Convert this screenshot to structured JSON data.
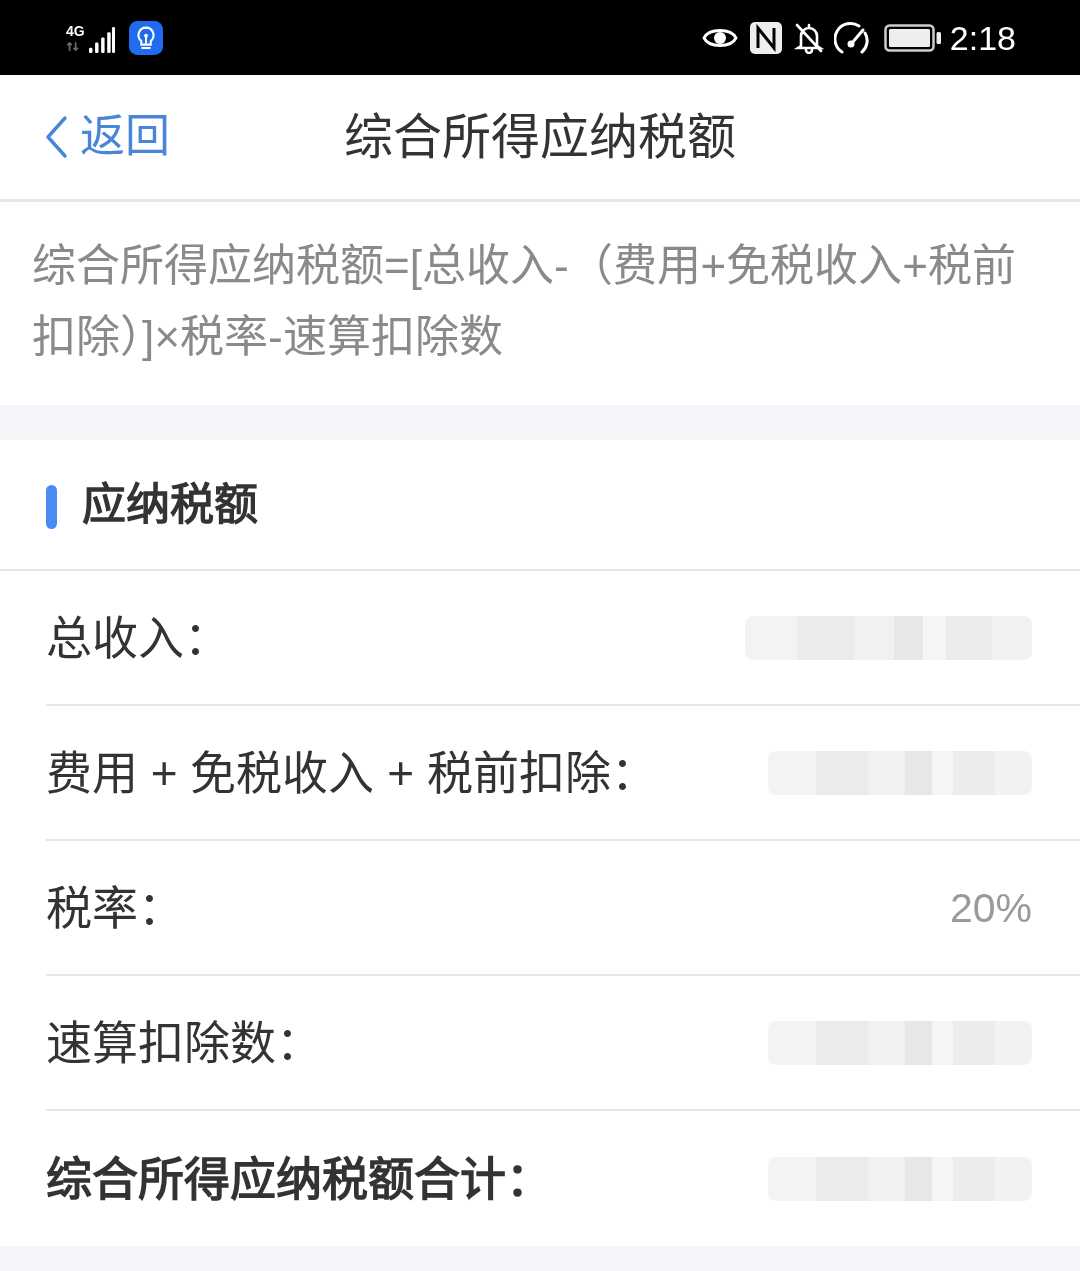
{
  "status_bar": {
    "network": "4G",
    "time": "2:18"
  },
  "nav_bar": {
    "back": "返回",
    "title": "综合所得应纳税额"
  },
  "formula": "综合所得应纳税额=[总收入-（费用+免税收入+税前扣除）]×税率-速算扣除数",
  "section": {
    "title": "应纳税额",
    "rows": [
      {
        "label": "总收入：",
        "blurred": true,
        "emphasized": false
      },
      {
        "label": "费用 + 免税收入 + 税前扣除：",
        "blurred": true,
        "emphasized": false
      },
      {
        "label": "税率：",
        "blurred": false,
        "value": "20%",
        "emphasized": false
      },
      {
        "label": "速算扣除数：",
        "blurred": true,
        "emphasized": false
      },
      {
        "label": "综合所得应纳税额合计：",
        "blurred": true,
        "emphasized": true
      }
    ]
  }
}
